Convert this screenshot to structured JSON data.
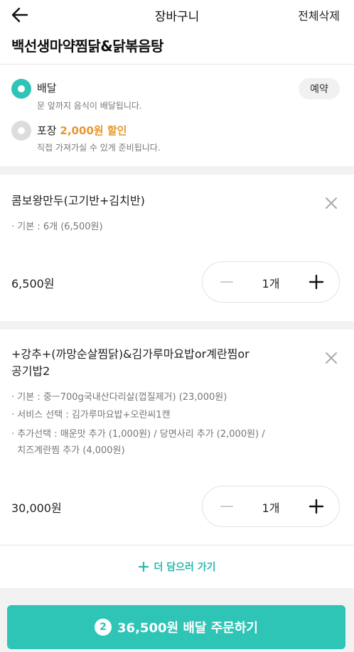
{
  "header": {
    "title": "장바구니",
    "clear_all": "전체삭제",
    "back_icon": "arrow-left-icon"
  },
  "store": {
    "name": "백선생마약찜닭&닭볶음탕"
  },
  "order_type": {
    "delivery": {
      "label": "배달",
      "description": "문 앞까지 음식이 배달됩니다.",
      "selected": true
    },
    "pickup": {
      "label": "포장",
      "discount": "2,000원 할인",
      "description": "직접 가져가실 수 있게 준비됩니다.",
      "selected": false
    },
    "reserve_label": "예약"
  },
  "cart_items": [
    {
      "name": "콤보왕만두(고기반+김치반)",
      "options": [
        "· 기본 : 6개 (6,500원)"
      ],
      "price": "6,500원",
      "quantity": "1개"
    },
    {
      "name_lines": [
        "+강추+(까망순살찜닭)&김가루마요밥or계란찜or",
        "공기밥2"
      ],
      "options": [
        "· 기본 : 중ㅡ700g국내산다리살(껍질제거) (23,000원)",
        "· 서비스 선택 : 김가루마요밥+오란씨1캔",
        "· 추가선택 : 매운맛 추가 (1,000원) / 당면사리 추가 (2,000원) /",
        "  치즈계란찜 추가 (4,000원)"
      ],
      "price": "30,000원",
      "quantity": "1개"
    }
  ],
  "add_more": {
    "label": "더 담으러 가기"
  },
  "order_button": {
    "count": "2",
    "label": "36,500원 배달 주문하기"
  },
  "colors": {
    "accent": "#2ec4b6",
    "discount": "#e8962e"
  }
}
